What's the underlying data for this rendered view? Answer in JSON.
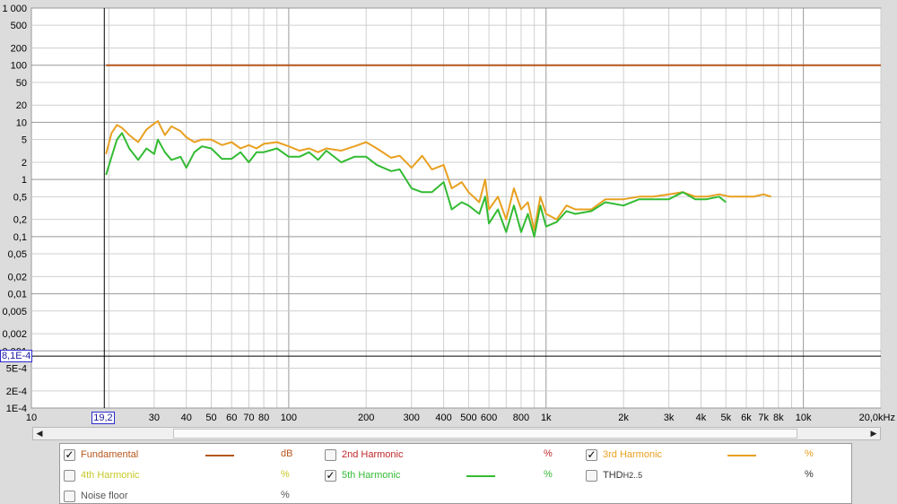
{
  "chart_data": {
    "type": "line",
    "title": "",
    "xlabel": "",
    "ylabel": "",
    "x_scale": "log",
    "y_scale": "log",
    "xlim": [
      10,
      20000
    ],
    "ylim": [
      0.0001,
      1000
    ],
    "grid": true,
    "x_ticks": [
      "10",
      "20",
      "30",
      "40",
      "50",
      "60",
      "70",
      "80",
      "100",
      "200",
      "300",
      "400",
      "500",
      "600",
      "800",
      "1k",
      "2k",
      "3k",
      "4k",
      "5k",
      "6k",
      "7k",
      "8k",
      "10k",
      "20,0kHz"
    ],
    "y_ticks": [
      "1 000",
      "500",
      "200",
      "100",
      "50",
      "20",
      "10",
      "5",
      "2",
      "1",
      "0,5",
      "0,2",
      "0,1",
      "0,05",
      "0,02",
      "0,01",
      "0,005",
      "0,002",
      "0,001",
      "5E-4",
      "2E-4",
      "1E-4"
    ],
    "cursor": {
      "x_label": "19,2",
      "y_label": "8,1E-4",
      "x_value": 19.2,
      "y_value": 0.00081
    },
    "series": [
      {
        "name": "Fundamental",
        "color": "#b5561a",
        "x": [
          19.5,
          20000
        ],
        "y": [
          100,
          100
        ]
      },
      {
        "name": "3rd Harmonic",
        "color": "#e8a020",
        "x": [
          19.5,
          20.5,
          21.5,
          22.5,
          24,
          26,
          28,
          30,
          31,
          33,
          35,
          38,
          40,
          43,
          46,
          50,
          55,
          60,
          65,
          70,
          75,
          80,
          90,
          100,
          110,
          120,
          130,
          140,
          160,
          180,
          200,
          220,
          250,
          270,
          300,
          330,
          360,
          400,
          430,
          470,
          500,
          550,
          580,
          600,
          650,
          700,
          750,
          800,
          850,
          900,
          950,
          1000,
          1100,
          1200,
          1300,
          1500,
          1700,
          2000,
          2300,
          2600,
          3000,
          3400,
          3800,
          4200,
          4700,
          5200,
          5800,
          6400,
          7000,
          7500
        ],
        "y": [
          2.8,
          6.5,
          9.0,
          8.0,
          6.0,
          4.5,
          7.5,
          9.5,
          10.5,
          6.0,
          8.5,
          7.0,
          5.5,
          4.5,
          5.0,
          5.0,
          4.0,
          4.5,
          3.5,
          4.0,
          3.5,
          4.2,
          4.5,
          3.8,
          3.2,
          3.5,
          3.0,
          3.5,
          3.2,
          3.8,
          4.5,
          3.5,
          2.4,
          2.6,
          1.6,
          2.6,
          1.5,
          1.8,
          0.7,
          0.9,
          0.6,
          0.4,
          1.0,
          0.3,
          0.5,
          0.2,
          0.7,
          0.3,
          0.4,
          0.13,
          0.5,
          0.25,
          0.2,
          0.35,
          0.3,
          0.3,
          0.45,
          0.45,
          0.5,
          0.5,
          0.55,
          0.6,
          0.5,
          0.5,
          0.55,
          0.5,
          0.5,
          0.5,
          0.55,
          0.5
        ]
      },
      {
        "name": "5th Harmonic",
        "color": "#33bb33",
        "x": [
          19.5,
          20.5,
          21.5,
          22.5,
          24,
          26,
          28,
          30,
          31,
          33,
          35,
          38,
          40,
          43,
          46,
          50,
          55,
          60,
          65,
          70,
          75,
          80,
          90,
          100,
          110,
          120,
          130,
          140,
          160,
          180,
          200,
          220,
          250,
          270,
          300,
          330,
          360,
          400,
          430,
          470,
          500,
          550,
          580,
          600,
          650,
          700,
          750,
          800,
          850,
          900,
          950,
          1000,
          1100,
          1200,
          1300,
          1500,
          1700,
          2000,
          2300,
          2600,
          3000,
          3400,
          3800,
          4200,
          4700,
          5000
        ],
        "y": [
          1.2,
          2.5,
          5.0,
          6.5,
          3.5,
          2.2,
          3.5,
          2.8,
          5.0,
          3.0,
          2.2,
          2.5,
          1.6,
          3.0,
          3.8,
          3.5,
          2.3,
          2.3,
          3.0,
          2.0,
          3.0,
          3.0,
          3.5,
          2.5,
          2.5,
          3.0,
          2.2,
          3.2,
          2.0,
          2.5,
          2.5,
          1.8,
          1.4,
          1.5,
          0.7,
          0.6,
          0.6,
          0.9,
          0.3,
          0.4,
          0.35,
          0.25,
          0.5,
          0.17,
          0.3,
          0.12,
          0.35,
          0.12,
          0.25,
          0.1,
          0.35,
          0.15,
          0.18,
          0.28,
          0.25,
          0.28,
          0.4,
          0.35,
          0.45,
          0.45,
          0.45,
          0.6,
          0.45,
          0.45,
          0.5,
          0.4
        ]
      }
    ]
  },
  "scrollbar": {
    "left_arrow": "◀",
    "right_arrow": "▶"
  },
  "legend": {
    "items": [
      {
        "label": "Fundamental",
        "unit": "dB",
        "checked": true,
        "color": "#b5561a",
        "show_line": true
      },
      {
        "label": "2nd Harmonic",
        "unit": "%",
        "checked": false,
        "color": "#c0282a",
        "show_line": false
      },
      {
        "label": "3rd Harmonic",
        "unit": "%",
        "checked": true,
        "color": "#e8a020",
        "show_line": true
      },
      {
        "label": "4th Harmonic",
        "unit": "%",
        "checked": false,
        "color": "#c8c828",
        "show_line": false
      },
      {
        "label": "5th Harmonic",
        "unit": "%",
        "checked": true,
        "color": "#33bb33",
        "show_line": true
      },
      {
        "label": "THD",
        "subscript": "H2..5",
        "unit": "%",
        "checked": false,
        "color": "#333333",
        "show_line": false
      },
      {
        "label": "Noise floor",
        "unit": "%",
        "checked": false,
        "color": "#555555",
        "show_line": false
      }
    ]
  }
}
